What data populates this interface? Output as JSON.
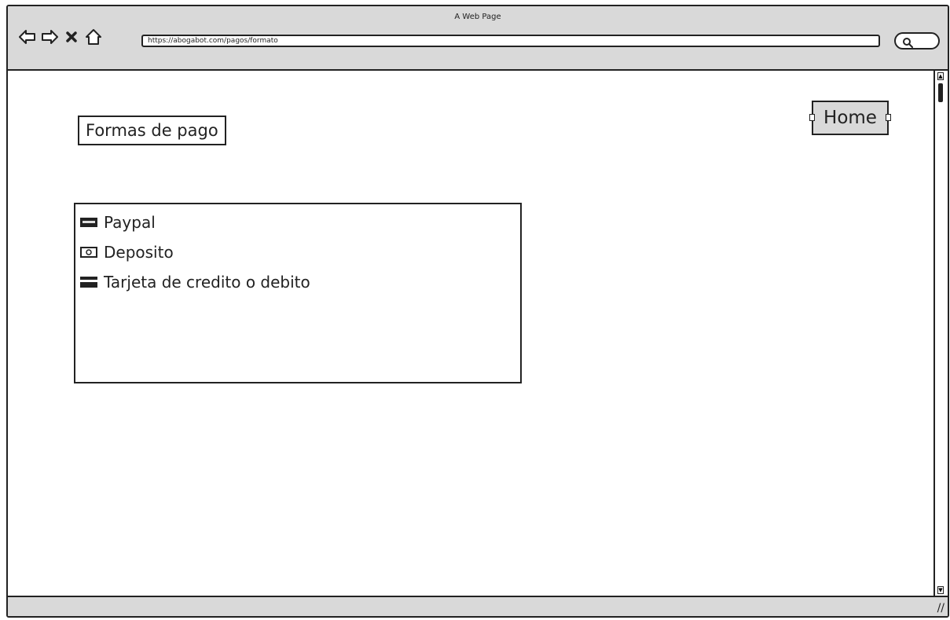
{
  "window": {
    "title": "A Web Page",
    "url": "https://abogabot.com/pagos/formato"
  },
  "nav": {
    "back_icon": "back-arrow-icon",
    "forward_icon": "forward-arrow-icon",
    "stop_icon": "close-icon",
    "home_icon": "home-icon",
    "search_icon": "search-icon"
  },
  "page": {
    "title": "Formas de pago",
    "home_button": "Home"
  },
  "payment_methods": [
    {
      "label": "Paypal",
      "icon": "paypal-icon"
    },
    {
      "label": "Deposito",
      "icon": "cash-icon"
    },
    {
      "label": "Tarjeta de credito o debito",
      "icon": "credit-card-icon"
    }
  ],
  "colors": {
    "chrome": "#d9d9d9",
    "stroke": "#222222",
    "background": "#ffffff"
  }
}
